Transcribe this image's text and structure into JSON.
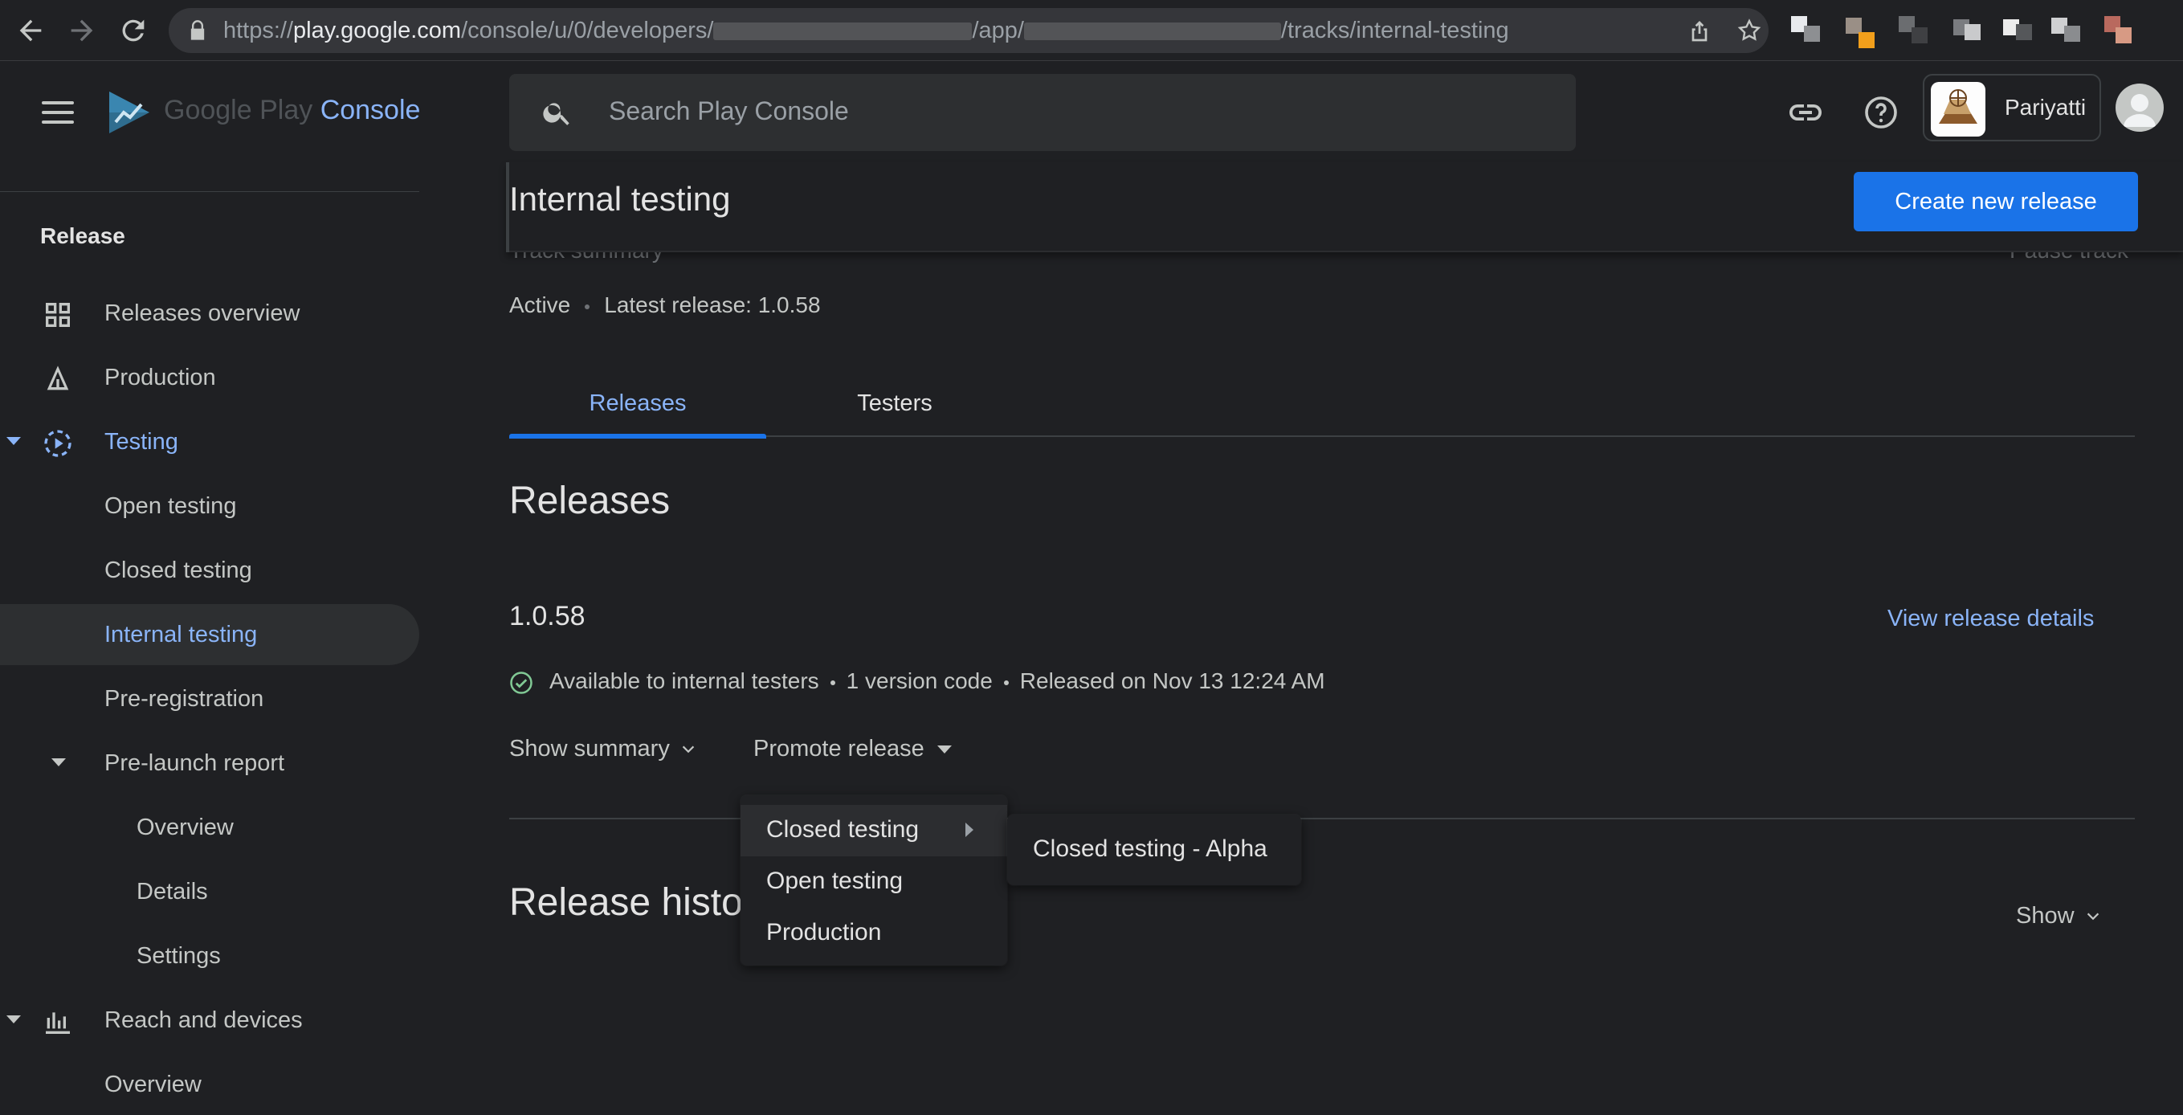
{
  "browser": {
    "url_prefix": "https://",
    "url_host": "play.google.com",
    "url_path_1": "/console/u/0/developers/",
    "url_path_2": "/app/",
    "url_path_3": "/tracks/internal-testing"
  },
  "brand": {
    "name_part1": "Google Play",
    "name_part2": "Console"
  },
  "search": {
    "placeholder": "Search Play Console"
  },
  "account": {
    "app_name": "Pariyatti"
  },
  "sidebar": {
    "section": "Release",
    "items": [
      {
        "label": "Releases overview"
      },
      {
        "label": "Production"
      },
      {
        "label": "Testing"
      },
      {
        "label": "Open testing"
      },
      {
        "label": "Closed testing"
      },
      {
        "label": "Internal testing"
      },
      {
        "label": "Pre-registration"
      },
      {
        "label": "Pre-launch report"
      },
      {
        "label": "Overview"
      },
      {
        "label": "Details"
      },
      {
        "label": "Settings"
      },
      {
        "label": "Reach and devices"
      },
      {
        "label": "Overview"
      }
    ]
  },
  "page": {
    "title": "Internal testing",
    "create_button": "Create new release",
    "peek_left": "Track summary",
    "peek_right": "Pause track",
    "status": "Active",
    "latest_release": "Latest release: 1.0.58",
    "tabs": [
      {
        "label": "Releases"
      },
      {
        "label": "Testers"
      }
    ],
    "releases_heading": "Releases",
    "release": {
      "version": "1.0.58",
      "details_link": "View release details",
      "availability": "Available to internal testers",
      "version_codes": "1 version code",
      "released_on": "Released on Nov 13 12:24 AM",
      "show_summary": "Show summary",
      "promote": "Promote release"
    },
    "history_heading": "Release history",
    "show_label": "Show"
  },
  "promote_menu": {
    "items": [
      {
        "label": "Closed testing"
      },
      {
        "label": "Open testing"
      },
      {
        "label": "Production"
      }
    ],
    "submenu": [
      {
        "label": "Closed testing - Alpha"
      }
    ]
  },
  "colors": {
    "accent": "#8ab4f8",
    "primary_button": "#1a73e8",
    "success": "#81c995",
    "background": "#1f2023"
  }
}
